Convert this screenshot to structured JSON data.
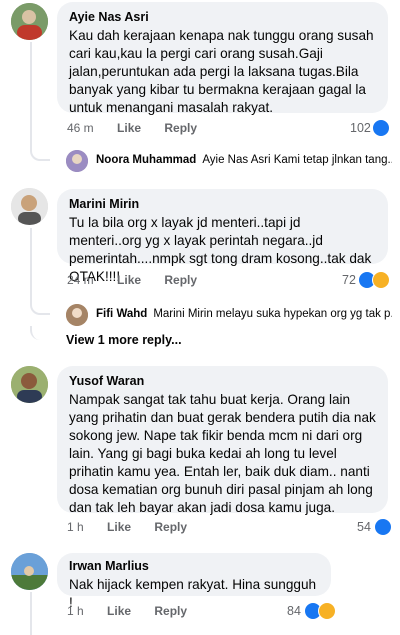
{
  "comments": [
    {
      "name": "Ayie Nas Asri",
      "text": "Kau dah kerajaan kenapa nak tunggu orang susah cari kau,kau la pergi cari orang susah.Gaji jalan,peruntukan ada pergi la laksana tugas.Bila banyak yang kibar tu bermakna kerajaan gagal la untuk menangani masalah rakyat.",
      "time": "46 m",
      "like": "Like",
      "reply": "Reply",
      "count": "102"
    },
    {
      "name": "Marini Mirin",
      "text": "Tu la bila org x layak jd menteri..tapi jd menteri..org yg x layak perintah negara..jd pemerintah....nmpk sgt tong dram kosong..tak dak OTAK!!!!",
      "time": "24 m",
      "like": "Like",
      "reply": "Reply",
      "count": "72"
    },
    {
      "name": "Yusof Waran",
      "text": "Nampak sangat tak tahu buat kerja. Orang lain yang prihatin dan buat gerak bendera putih dia nak sokong jew. Nape tak fikir benda mcm ni dari org lain. Yang gi bagi buka kedai ah long tu level prihatin kamu yea. Entah ler, baik duk diam.. nanti dosa kematian org bunuh diri pasal pinjam ah long dan tak leh bayar akan jadi dosa kamu juga.",
      "time": "1 h",
      "like": "Like",
      "reply": "Reply",
      "count": "54"
    },
    {
      "name": "Irwan Marlius",
      "text": "Nak hijack kempen rakyat. Hina sungguh !",
      "time": "1 h",
      "like": "Like",
      "reply": "Reply",
      "count": "84"
    }
  ],
  "replies": [
    {
      "name": "Noora Muhammad",
      "text": "Ayie Nas Asri Kami tetap jlnkan tang..."
    },
    {
      "name": "Fifi Wahd",
      "text": "Marini Mirin melayu suka hypekan org yg tak p..."
    }
  ],
  "view_more": "View 1 more reply...",
  "colors": {
    "bubble": "#f0f2f5",
    "like": "#1877f2",
    "haha": "#f7b125",
    "meta": "#65676b"
  }
}
